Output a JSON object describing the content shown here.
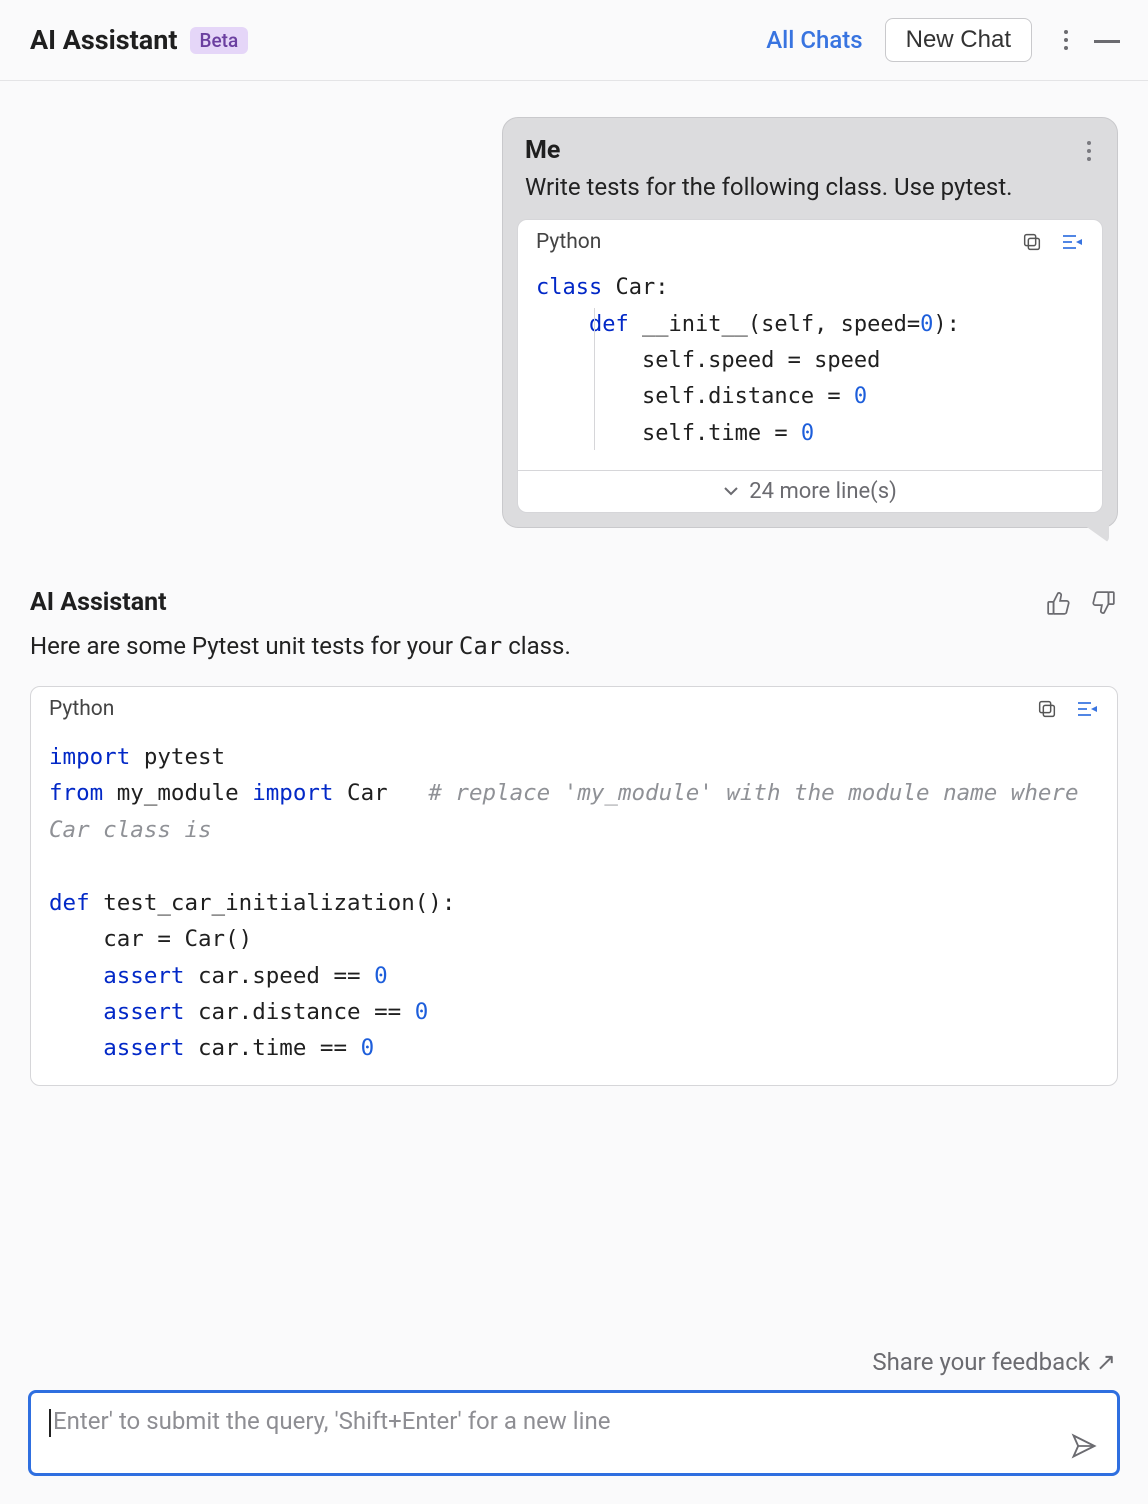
{
  "header": {
    "title": "AI Assistant",
    "badge": "Beta",
    "all_chats": "All Chats",
    "new_chat": "New Chat"
  },
  "user_message": {
    "sender": "Me",
    "text": "Write tests for the following class. Use pytest.",
    "code_lang": "Python",
    "code_tokens": [
      {
        "t": "class ",
        "c": "kw"
      },
      {
        "t": "Car:\n"
      },
      {
        "t": "    "
      },
      {
        "t": "def ",
        "c": "kw"
      },
      {
        "t": "__init__(self, speed="
      },
      {
        "t": "0",
        "c": "num"
      },
      {
        "t": "):\n"
      },
      {
        "t": "        self.speed = speed\n"
      },
      {
        "t": "        self.distance = "
      },
      {
        "t": "0",
        "c": "num"
      },
      {
        "t": "\n"
      },
      {
        "t": "        self.time = "
      },
      {
        "t": "0",
        "c": "num"
      }
    ],
    "more_lines": "24 more line(s)"
  },
  "assistant_message": {
    "sender": "AI Assistant",
    "text_pre": "Here are some Pytest unit tests for your ",
    "text_mono": "Car",
    "text_post": " class.",
    "code_lang": "Python",
    "code_tokens": [
      {
        "t": "import ",
        "c": "kw"
      },
      {
        "t": "pytest\n"
      },
      {
        "t": "from ",
        "c": "kw"
      },
      {
        "t": "my_module "
      },
      {
        "t": "import ",
        "c": "kw"
      },
      {
        "t": "Car   "
      },
      {
        "t": "# replace 'my_module' with the module name where Car class is",
        "c": "cmt"
      },
      {
        "t": "\n\n"
      },
      {
        "t": "def ",
        "c": "kw"
      },
      {
        "t": "test_car_initialization():\n"
      },
      {
        "t": "    car = Car()\n"
      },
      {
        "t": "    "
      },
      {
        "t": "assert ",
        "c": "kw"
      },
      {
        "t": "car.speed == "
      },
      {
        "t": "0",
        "c": "num"
      },
      {
        "t": "\n"
      },
      {
        "t": "    "
      },
      {
        "t": "assert ",
        "c": "kw"
      },
      {
        "t": "car.distance == "
      },
      {
        "t": "0",
        "c": "num"
      },
      {
        "t": "\n"
      },
      {
        "t": "    "
      },
      {
        "t": "assert ",
        "c": "kw"
      },
      {
        "t": "car.time == "
      },
      {
        "t": "0",
        "c": "num"
      }
    ]
  },
  "footer": {
    "feedback": "Share your feedback ↗",
    "placeholder": "Enter' to submit the query, 'Shift+Enter' for a new line"
  }
}
